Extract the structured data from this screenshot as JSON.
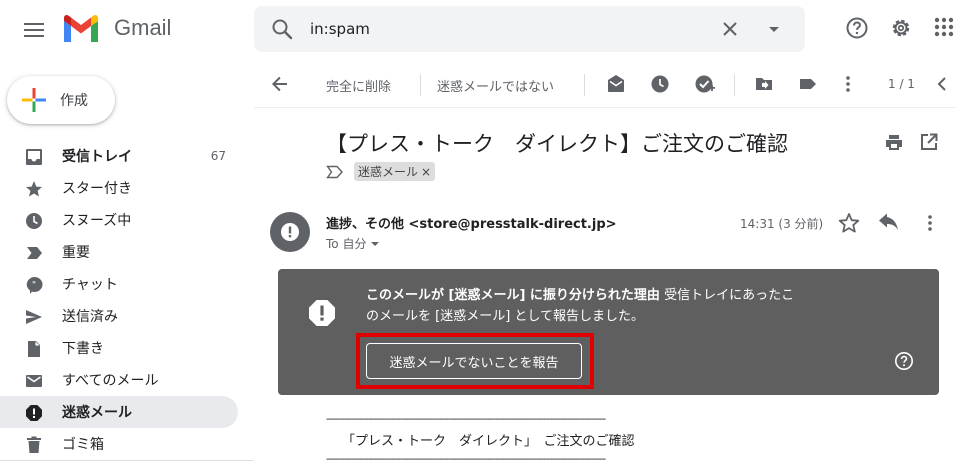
{
  "header": {
    "app_name": "Gmail",
    "search_value": "in:spam"
  },
  "sidebar": {
    "compose_label": "作成",
    "items": [
      {
        "label": "受信トレイ",
        "count": "67",
        "icon": "inbox-icon"
      },
      {
        "label": "スター付き",
        "count": "",
        "icon": "star-icon"
      },
      {
        "label": "スヌーズ中",
        "count": "",
        "icon": "clock-icon"
      },
      {
        "label": "重要",
        "count": "",
        "icon": "important-icon"
      },
      {
        "label": "チャット",
        "count": "",
        "icon": "chat-icon"
      },
      {
        "label": "送信済み",
        "count": "",
        "icon": "send-icon"
      },
      {
        "label": "下書き",
        "count": "",
        "icon": "draft-icon"
      },
      {
        "label": "すべてのメール",
        "count": "",
        "icon": "mail-icon"
      },
      {
        "label": "迷惑メール",
        "count": "",
        "icon": "spam-icon"
      },
      {
        "label": "ゴミ箱",
        "count": "",
        "icon": "trash-icon"
      }
    ]
  },
  "toolbar": {
    "delete_forever": "完全に削除",
    "not_spam": "迷惑メールではない",
    "pagination": "1 / 1"
  },
  "message": {
    "subject": "【プレス・トーク　ダイレクト】ご注文のご確認",
    "label_chip": "迷惑メール",
    "sender": "進捗、その他 <store@presstalk-direct.jp>",
    "to": "To 自分",
    "time": "14:31 (3 分前)",
    "banner_bold": "このメールが [迷惑メール] に振り分けられた理由",
    "banner_text": " 受信トレイにあったこのメールを [迷惑メール] として報告しました。",
    "report_button": "迷惑メールでないことを報告",
    "body_dashes": "----------------------------------------------------------------------------------------------",
    "body_line": "「プレス・トーク　ダイレクト」　ご注文のご確認"
  },
  "colors": {
    "banner_bg": "#5f5f5f",
    "highlight": "#e00000",
    "active_nav": "#e8eaed"
  }
}
